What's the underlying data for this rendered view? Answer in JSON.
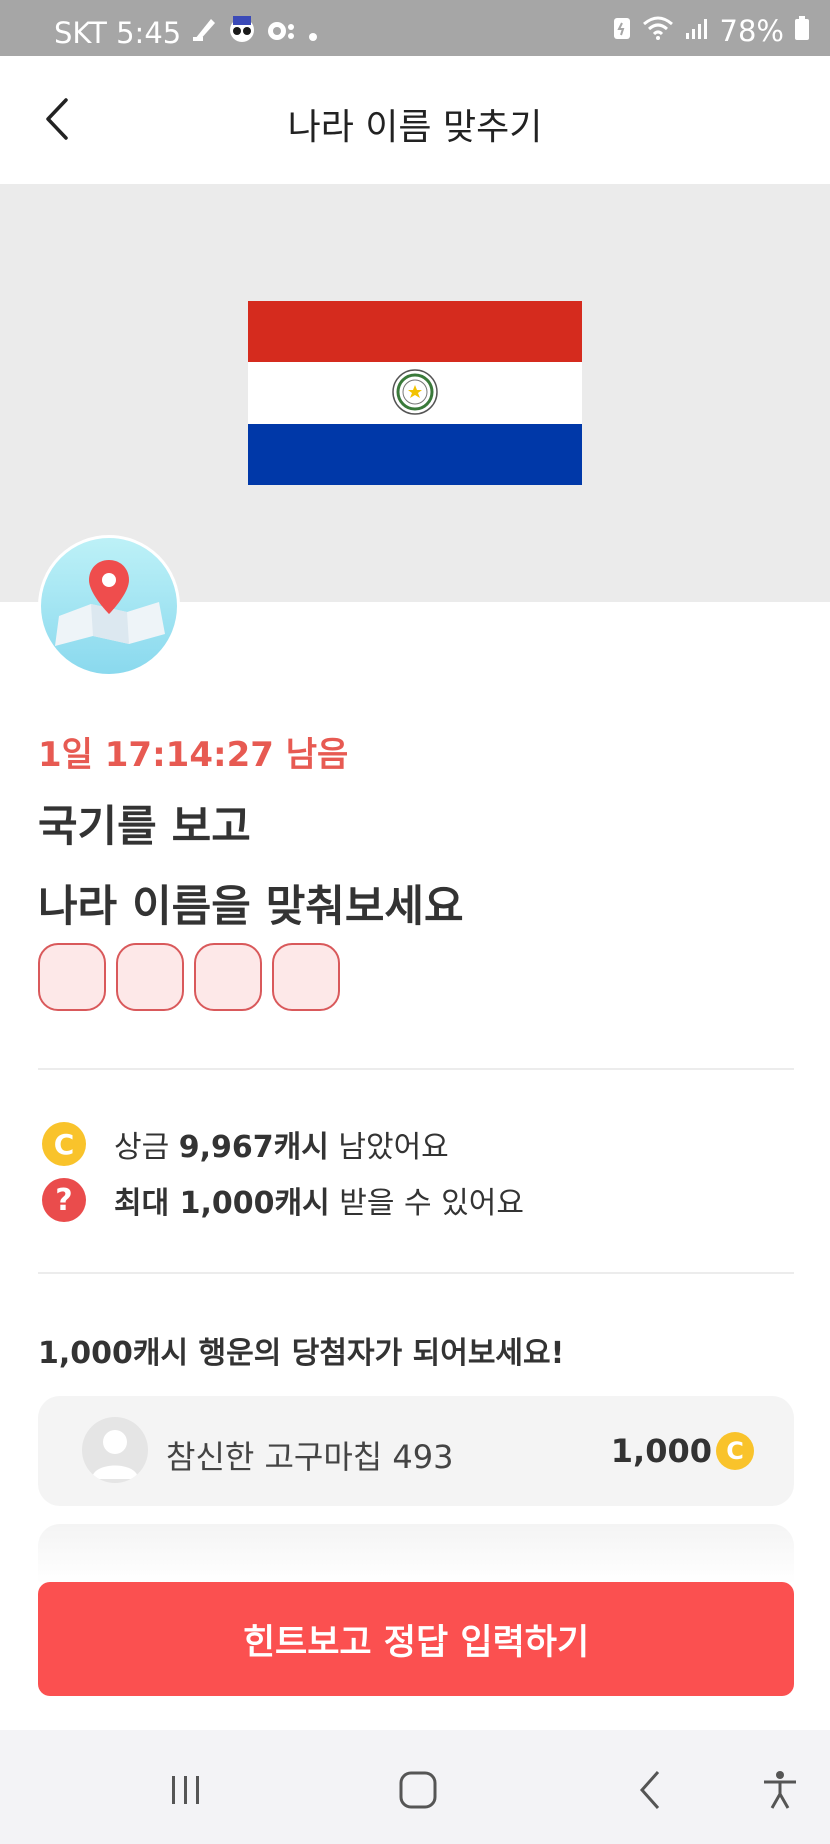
{
  "status_bar": {
    "carrier_time": "SKT 5:45",
    "battery": "78%"
  },
  "header": {
    "title": "나라 이름 맞추기"
  },
  "quiz": {
    "timer": "1일 17:14:27 남음",
    "title_line1": "국기를 보고",
    "title_line2": "나라 이름을 맞춰보세요",
    "answer_box_count": 4
  },
  "info": {
    "prize_prefix": "상금 ",
    "prize_amount": "9,967캐시",
    "prize_suffix": " 남았어요",
    "max_amount": "최대 1,000캐시",
    "max_suffix": " 받을 수 있어요"
  },
  "winners": {
    "heading": "1,000캐시 행운의 당첨자가 되어보세요!",
    "items": [
      {
        "name": "참신한 고구마칩 493",
        "amount": "1,000"
      }
    ]
  },
  "cta": {
    "label": "힌트보고 정답 입력하기"
  },
  "icons": {
    "coin": "coin-icon",
    "coin_letter": "C",
    "question": "question-icon",
    "question_glyph": "?"
  },
  "colors": {
    "accent": "#fb5050",
    "timer": "#e75a52",
    "coin": "#f9c32b",
    "flag_red": "#d52b1e",
    "flag_blue": "#0038a8"
  }
}
